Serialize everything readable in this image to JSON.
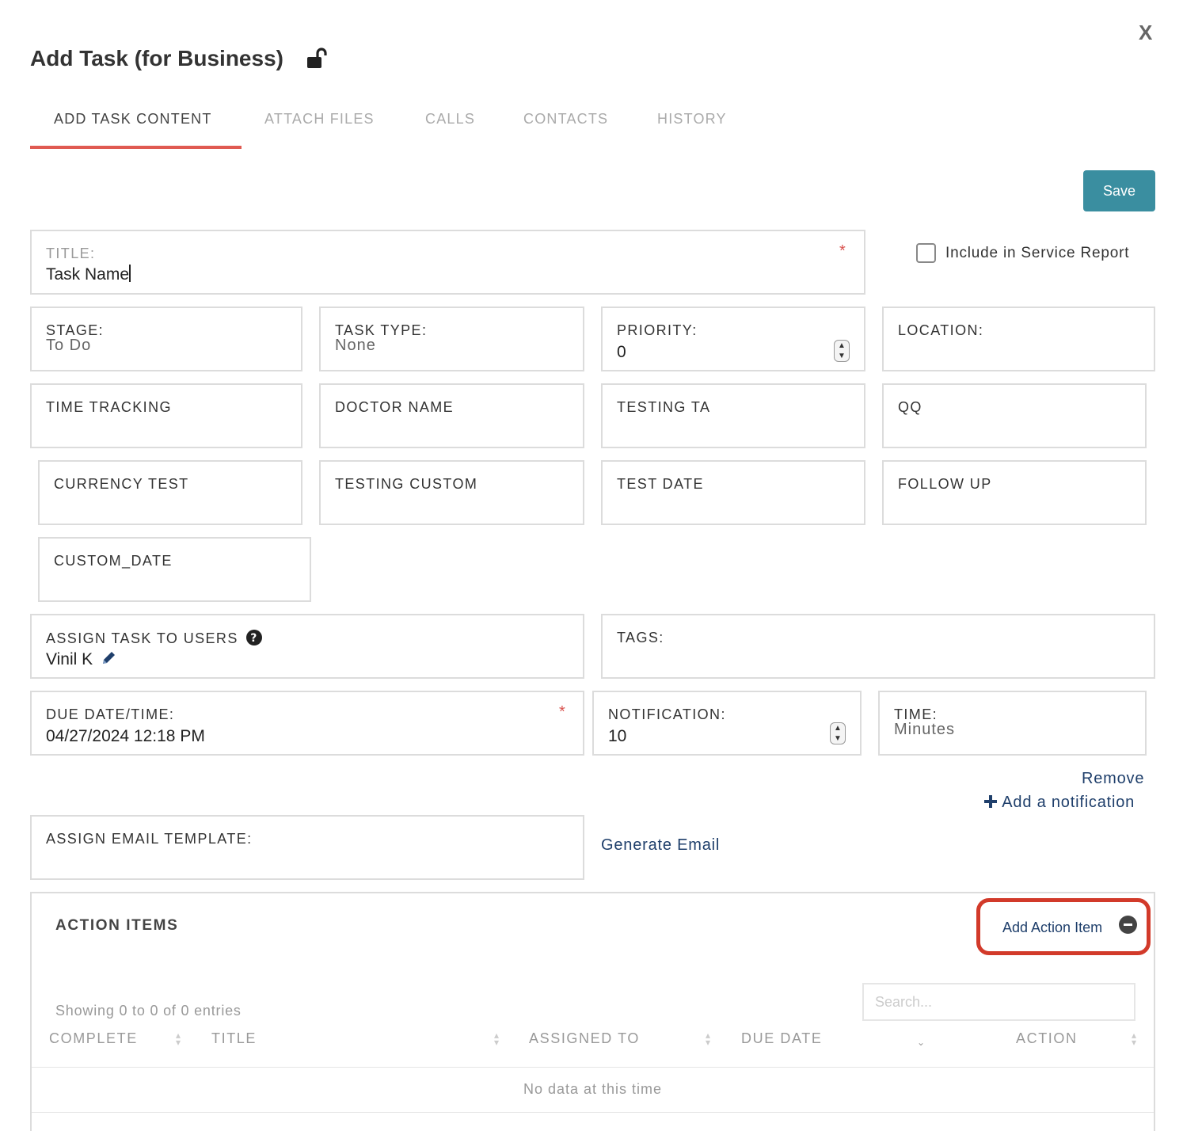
{
  "dialog": {
    "title": "Add Task (for Business)",
    "close_label": "X"
  },
  "tabs": [
    {
      "label": "ADD TASK CONTENT",
      "active": true
    },
    {
      "label": "ATTACH FILES",
      "active": false
    },
    {
      "label": "CALLS",
      "active": false
    },
    {
      "label": "CONTACTS",
      "active": false
    },
    {
      "label": "HISTORY",
      "active": false
    }
  ],
  "toolbar": {
    "save_label": "Save"
  },
  "form": {
    "title_label": "TITLE:",
    "title_value": "Task Name",
    "required_mark": "*",
    "include_in_report_label": "Include in Service Report",
    "include_in_report_checked": false,
    "stage_label": "STAGE:",
    "stage_value": "To Do",
    "task_type_label": "TASK TYPE:",
    "task_type_value": "None",
    "priority_label": "PRIORITY:",
    "priority_value": "0",
    "location_label": "LOCATION:",
    "time_tracking_label": "TIME TRACKING",
    "doctor_name_label": "DOCTOR NAME",
    "testing_ta_label": "TESTING TA",
    "qq_label": "QQ",
    "currency_test_label": "CURRENCY TEST",
    "testing_custom_label": "TESTING CUSTOM",
    "test_date_label": "TEST DATE",
    "follow_up_label": "FOLLOW UP",
    "custom_date_label": "CUSTOM_DATE",
    "assign_users_label": "ASSIGN TASK TO USERS",
    "assign_users_value": "Vinil K",
    "tags_label": "TAGS:",
    "due_label": "DUE DATE/TIME:",
    "due_value": "04/27/2024 12:18 PM",
    "notification_label": "NOTIFICATION:",
    "notification_value": "10",
    "time_label": "TIME:",
    "time_value": "Minutes",
    "remove_link": "Remove",
    "add_notification_link": "Add a notification",
    "email_template_label": "ASSIGN EMAIL TEMPLATE:",
    "generate_email_link": "Generate Email"
  },
  "action_items": {
    "heading": "ACTION ITEMS",
    "add_label": "Add Action Item",
    "search_placeholder": "Search...",
    "showing_text": "Showing 0 to 0 of 0 entries",
    "columns": [
      "COMPLETE",
      "TITLE",
      "ASSIGNED TO",
      "DUE DATE",
      "ACTION"
    ],
    "empty_text": "No data at this time"
  },
  "colors": {
    "accent": "#3a8ea0",
    "tab_underline": "#e05a52",
    "highlight_box": "#d23a2a",
    "link": "#1f3f6b",
    "required": "#d9534f"
  }
}
